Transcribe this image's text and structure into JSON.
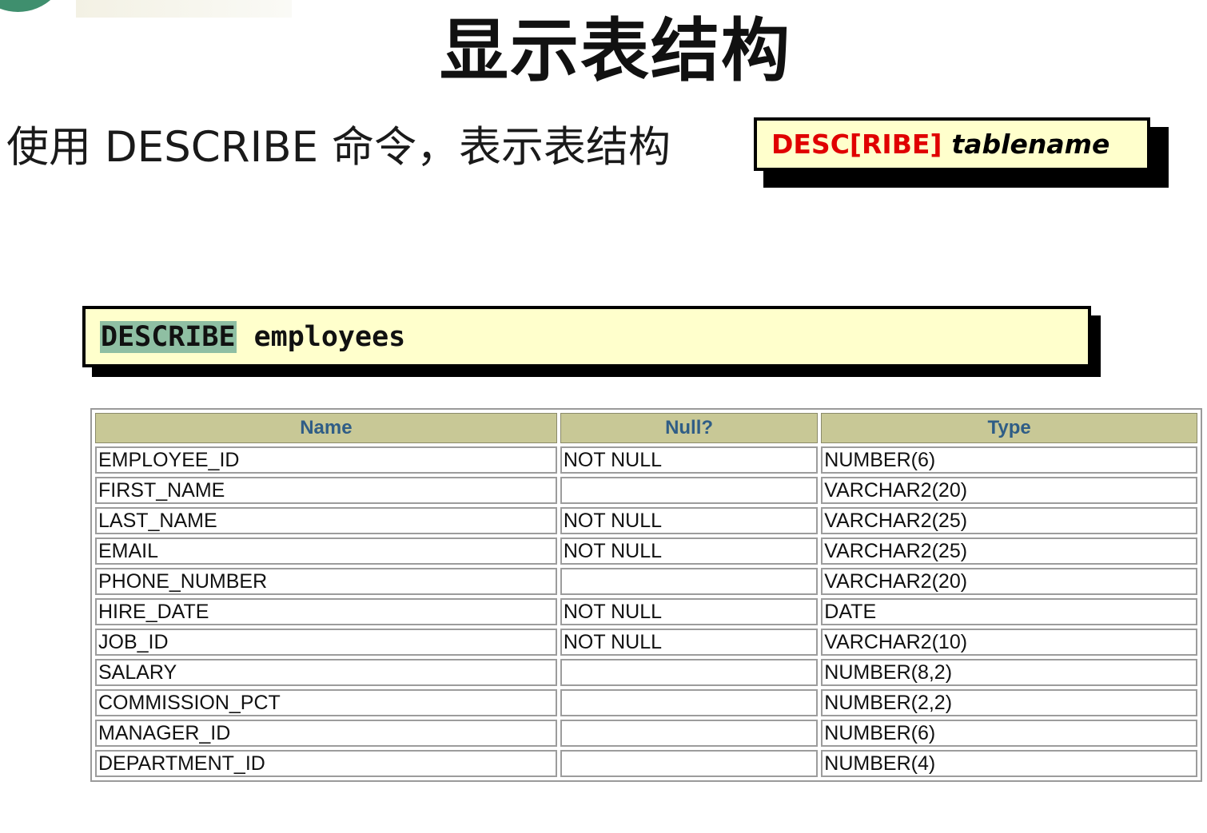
{
  "slide": {
    "title": "显示表结构",
    "subtitle": "使用 DESCRIBE 命令，表示表结构"
  },
  "syntax": {
    "keyword": "DESC[RIBE]",
    "parameter": "tablename"
  },
  "command": {
    "keyword": "DESCRIBE",
    "argument": "employees"
  },
  "table": {
    "headers": [
      "Name",
      "Null?",
      "Type"
    ],
    "rows": [
      {
        "name": "EMPLOYEE_ID",
        "null": "NOT NULL",
        "type": "NUMBER(6)"
      },
      {
        "name": "FIRST_NAME",
        "null": "",
        "type": "VARCHAR2(20)"
      },
      {
        "name": "LAST_NAME",
        "null": "NOT NULL",
        "type": "VARCHAR2(25)"
      },
      {
        "name": "EMAIL",
        "null": "NOT NULL",
        "type": "VARCHAR2(25)"
      },
      {
        "name": "PHONE_NUMBER",
        "null": "",
        "type": "VARCHAR2(20)"
      },
      {
        "name": "HIRE_DATE",
        "null": "NOT NULL",
        "type": "DATE"
      },
      {
        "name": "JOB_ID",
        "null": "NOT NULL",
        "type": "VARCHAR2(10)"
      },
      {
        "name": "SALARY",
        "null": "",
        "type": "NUMBER(8,2)"
      },
      {
        "name": "COMMISSION_PCT",
        "null": "",
        "type": "NUMBER(2,2)"
      },
      {
        "name": "MANAGER_ID",
        "null": "",
        "type": "NUMBER(6)"
      },
      {
        "name": "DEPARTMENT_ID",
        "null": "",
        "type": "NUMBER(4)"
      }
    ]
  },
  "colors": {
    "syntax_keyword": "#e00000",
    "box_background": "#ffffcc",
    "keyword_highlight": "#8fbfa3",
    "header_background": "#c8c896",
    "header_text": "#2f5d86"
  }
}
